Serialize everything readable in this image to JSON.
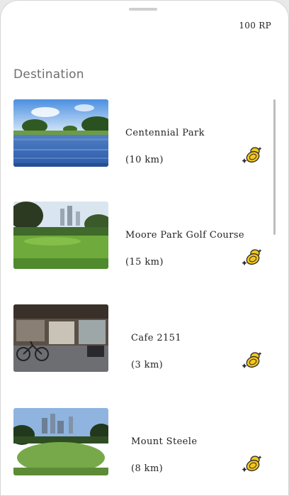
{
  "header": {
    "points": "100 RP"
  },
  "section": {
    "title": "Destination"
  },
  "destinations": [
    {
      "name": "Centennial Park",
      "distance": "(10 km)",
      "image": "lake-park-photo"
    },
    {
      "name": "Moore Park Golf Course",
      "distance": "(15 km)",
      "image": "golf-course-photo"
    },
    {
      "name": "Cafe 2151",
      "distance": "(3 km)",
      "image": "cafe-photo"
    },
    {
      "name": "Mount Steele",
      "distance": "(8 km)",
      "image": "city-hill-photo"
    }
  ],
  "icons": {
    "reward": "coins-icon"
  },
  "colors": {
    "coin": "#f3c61b",
    "coin_outline": "#2a2a2a"
  }
}
